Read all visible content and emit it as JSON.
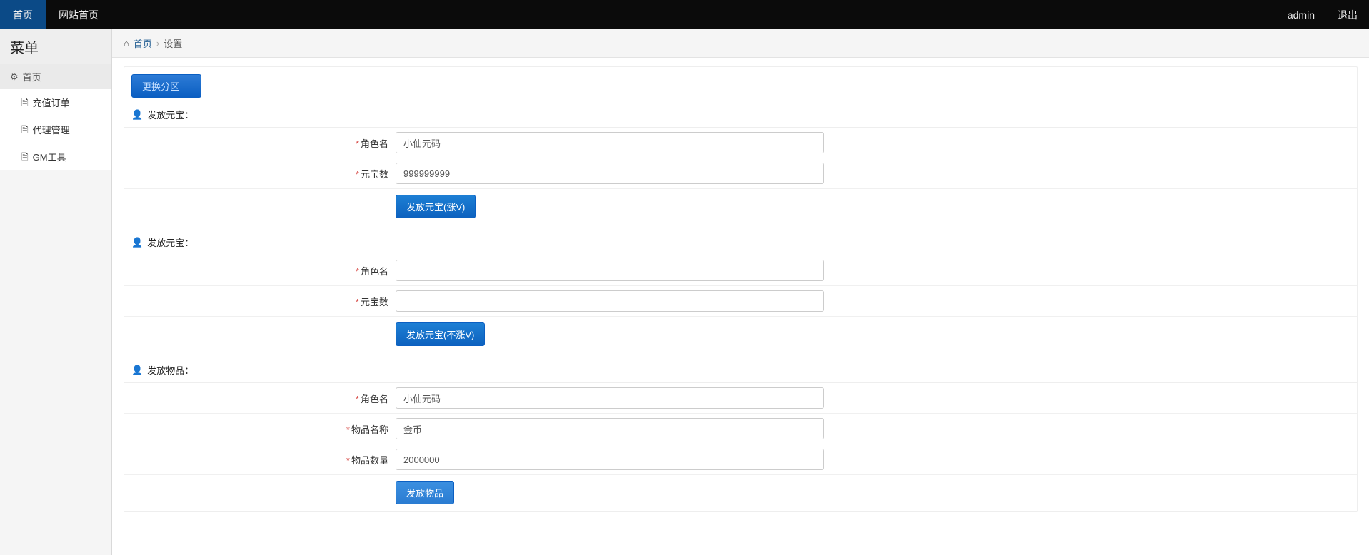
{
  "topnav": {
    "items": [
      {
        "label": "首页",
        "active": true
      },
      {
        "label": "网站首页",
        "active": false
      }
    ],
    "user": "admin",
    "logout": "退出"
  },
  "sidebar": {
    "title": "菜单",
    "group_label": "首页",
    "items": [
      {
        "label": "充值订单"
      },
      {
        "label": "代理管理"
      },
      {
        "label": "GM工具"
      }
    ]
  },
  "breadcrumb": {
    "home": "首页",
    "current": "设置"
  },
  "switch_button": "更换分区",
  "sections": [
    {
      "title": "发放元宝：",
      "fields": [
        {
          "label": "角色名",
          "value": "小仙元码"
        },
        {
          "label": "元宝数",
          "value": "999999999"
        }
      ],
      "button": "发放元宝(涨V)"
    },
    {
      "title": "发放元宝：",
      "fields": [
        {
          "label": "角色名",
          "value": ""
        },
        {
          "label": "元宝数",
          "value": ""
        }
      ],
      "button": "发放元宝(不涨V)"
    },
    {
      "title": "发放物品：",
      "fields": [
        {
          "label": "角色名",
          "value": "小仙元码"
        },
        {
          "label": "物品名称",
          "value": "金币"
        },
        {
          "label": "物品数量",
          "value": "2000000"
        }
      ],
      "button": "发放物品"
    }
  ]
}
